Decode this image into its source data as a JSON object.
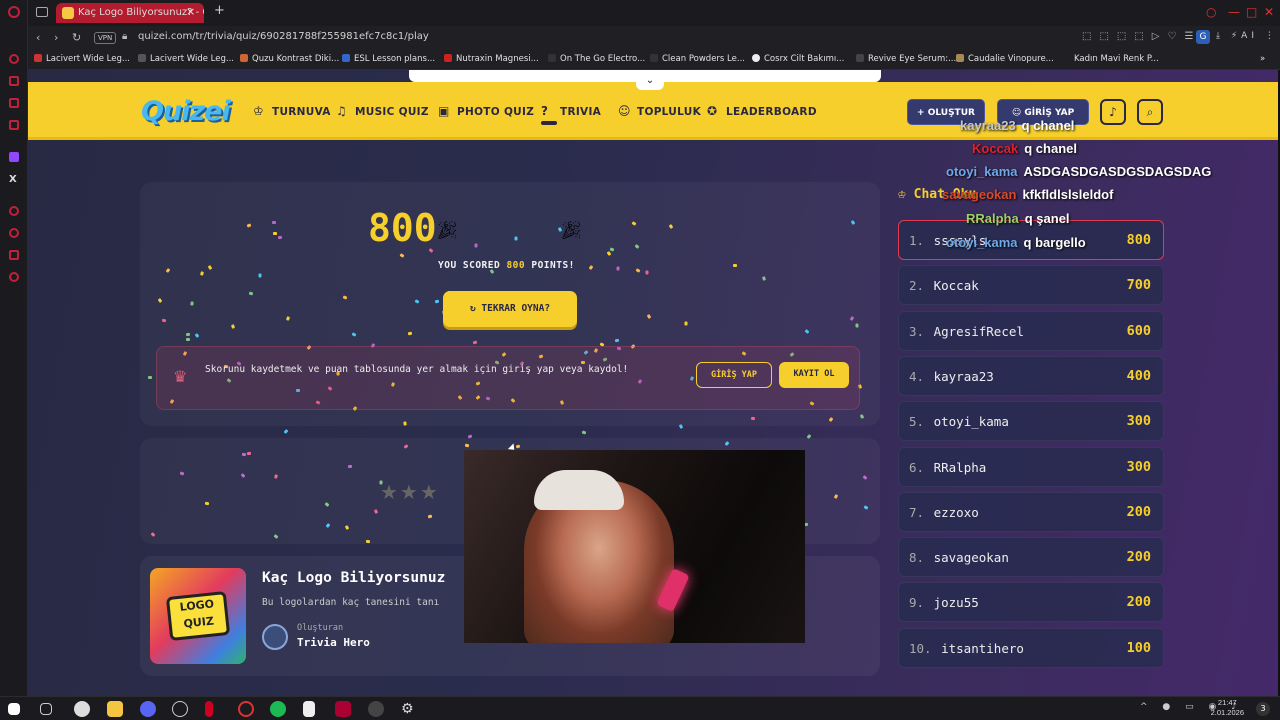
{
  "browser": {
    "tab_title": "Kaç Logo Biliyorsunuz? - Q",
    "url": "quizei.com/tr/trivia/quiz/690281788f255981efc7c8c1/play",
    "vpn_label": "VPN",
    "bookmarks": [
      "Lacivert Wide Leg...",
      "Lacivert Wide Leg...",
      "Quzu Kontrast Diki...",
      "ESL Lesson plans...",
      "Nutraxin Magnesi...",
      "On The Go Electro...",
      "Clean Powders Le...",
      "Cosrx Cilt Bakımı...",
      "Revive Eye Serum:...",
      "Caudalie Vinopure...",
      "Kadın Mavi Renk P..."
    ]
  },
  "header": {
    "logo": "Quizei",
    "nav": [
      {
        "label": "TURNUVA",
        "icon": "trophy-icon"
      },
      {
        "label": "MUSIC QUIZ",
        "icon": "music-icon"
      },
      {
        "label": "PHOTO QUIZ",
        "icon": "camera-icon"
      },
      {
        "label": "TRIVIA",
        "icon": "question-icon"
      },
      {
        "label": "TOPLULUK",
        "icon": "users-icon"
      },
      {
        "label": "LEADERBOARD",
        "icon": "medal-icon"
      }
    ],
    "create_label": "+ OLUŞTUR",
    "login_label": "GİRİŞ YAP"
  },
  "result": {
    "score": "800",
    "scored_prefix": "YOU SCORED",
    "scored_value": "800",
    "scored_suffix": "POINTS!",
    "replay_label": "TEKRAR OYNA?",
    "save_prompt": "Skorunu kaydetmek ve puan tablosunda yer almak için giriş yap veya kaydol!",
    "login_label": "GİRİŞ YAP",
    "register_label": "KAYIT OL",
    "stars": "★★★"
  },
  "quiz": {
    "cover_text": "LOGO QUIZ",
    "title": "Kaç Logo Biliyorsunuz",
    "description": "Bu logolardan kaç tanesini tanı",
    "creator_label": "Oluşturan",
    "creator_name": "Trivia Hero"
  },
  "leaderboard": {
    "title": "Chat Oku",
    "rows": [
      {
        "rank": "1.",
        "name": "ssssyls",
        "points": "800"
      },
      {
        "rank": "2.",
        "name": "Koccak",
        "points": "700"
      },
      {
        "rank": "3.",
        "name": "AgresifRecel",
        "points": "600"
      },
      {
        "rank": "4.",
        "name": "kayraa23",
        "points": "400"
      },
      {
        "rank": "5.",
        "name": "otoyi_kama",
        "points": "300"
      },
      {
        "rank": "6.",
        "name": "RRalpha",
        "points": "300"
      },
      {
        "rank": "7.",
        "name": "ezzoxo",
        "points": "200"
      },
      {
        "rank": "8.",
        "name": "savageokan",
        "points": "200"
      },
      {
        "rank": "9.",
        "name": "jozu55",
        "points": "200"
      },
      {
        "rank": "10.",
        "name": "itsantihero",
        "points": "100"
      }
    ]
  },
  "chat": [
    {
      "user": "kayraa23",
      "msg": "q chanel",
      "color": "#c8c8c8"
    },
    {
      "user": "Koccak",
      "msg": "q chanel",
      "color": "#e02030"
    },
    {
      "user": "otoyi_kama",
      "msg": "ASDGASDGASDGSDAGSDAG",
      "color": "#6fa8e8"
    },
    {
      "user": "savageokan",
      "msg": "kfkfldlslsleldof",
      "color": "#d94a2a"
    },
    {
      "user": "RRalpha",
      "msg": "q şanel",
      "color": "#9ad06a"
    },
    {
      "user": "otoyi_kama",
      "msg": "q bargello",
      "color": "#6fa8e8"
    }
  ],
  "taskbar": {
    "time": "21:47",
    "date": "2.01.2026",
    "notif_count": "3"
  },
  "colors": {
    "accent_yellow": "#f6cf2d",
    "nav_dark": "#2a2740",
    "highlight_red": "#e03a4e"
  }
}
